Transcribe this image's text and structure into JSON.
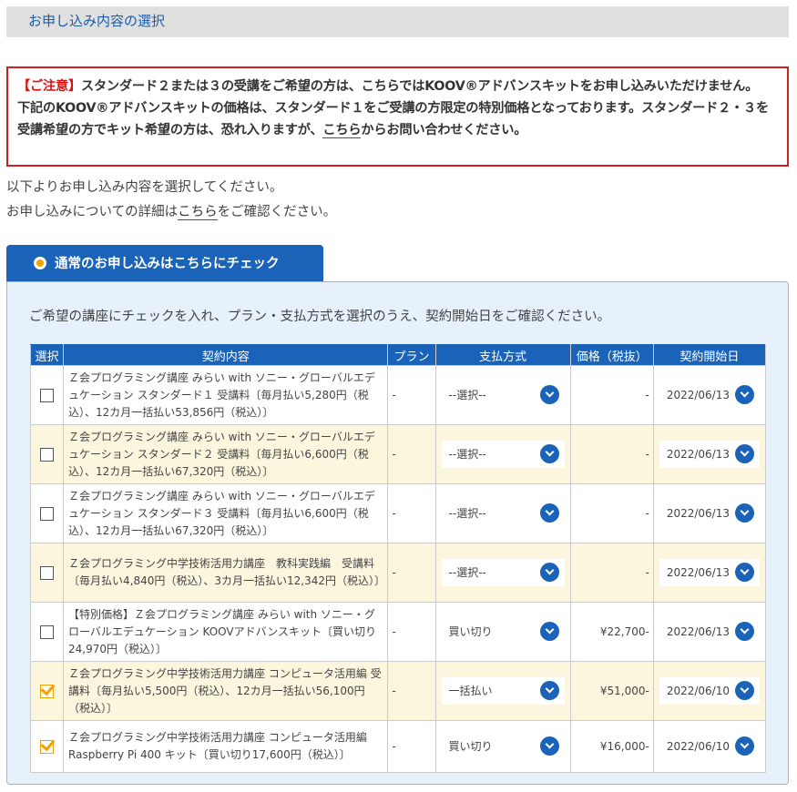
{
  "header": {
    "title": "お申し込み内容の選択"
  },
  "notice": {
    "tag": "【ご注意】",
    "line1": "スタンダード２または３の受講をご希望の方は、こちらではKOOV®アドバンスキットをお申し込みいただけません。",
    "line2_pre": "下記のKOOV®アドバンスキットの価格は、スタンダード１をご受講の方限定の特別価格となっております。スタンダード２・３を受講希望の方でキット希望の方は、恐れ入りますが、",
    "line2_link": "こちら",
    "line2_post": "からお問い合わせください。"
  },
  "intro": {
    "line1": "以下よりお申し込み内容を選択してください。",
    "line2_pre": "お申し込みについての詳細は",
    "line2_link": "こちら",
    "line2_post": "をご確認ください。"
  },
  "tab": {
    "label": "通常のお申し込みはこちらにチェック"
  },
  "panel": {
    "description": "ご希望の講座にチェックを入れ、プラン・支払方式を選択のうえ、契約開始日をご確認ください。"
  },
  "table": {
    "headers": [
      "選択",
      "契約内容",
      "プラン",
      "支払方式",
      "価格（税抜）",
      "契約開始日"
    ],
    "rows": [
      {
        "checked": false,
        "content": "Ｚ会プログラミング講座 みらい with ソニー・グローバルエデュケーション スタンダード１ 受講料〔毎月払い5,280円（税込）、12カ月一括払い53,856円（税込）〕",
        "plan": "-",
        "payment": "--選択--",
        "price": "-",
        "date": "2022/06/13"
      },
      {
        "checked": false,
        "content": "Ｚ会プログラミング講座 みらい with ソニー・グローバルエデュケーション スタンダード２ 受講料〔毎月払い6,600円（税込）、12カ月一括払い67,320円（税込）〕",
        "plan": "-",
        "payment": "--選択--",
        "price": "-",
        "date": "2022/06/13"
      },
      {
        "checked": false,
        "content": "Ｚ会プログラミング講座 みらい with ソニー・グローバルエデュケーション スタンダード３ 受講料〔毎月払い6,600円（税込）、12カ月一括払い67,320円（税込）〕",
        "plan": "-",
        "payment": "--選択--",
        "price": "-",
        "date": "2022/06/13"
      },
      {
        "checked": false,
        "content": "Ｚ会プログラミング中学技術活用力講座　教科実践編　受講料〔毎月払い4,840円（税込）、3カ月一括払い12,342円（税込）〕",
        "plan": "-",
        "payment": "--選択--",
        "price": "-",
        "date": "2022/06/13"
      },
      {
        "checked": false,
        "content": "【特別価格】Ｚ会プログラミング講座 みらい with ソニー・グローバルエデュケーション KOOVアドバンスキット〔買い切り24,970円（税込）〕",
        "plan": "-",
        "payment": "買い切り",
        "price": "¥22,700-",
        "date": "2022/06/13"
      },
      {
        "checked": true,
        "content": "Ｚ会プログラミング中学技術活用力講座 コンピュータ活用編 受講料〔毎月払い5,500円（税込）、12カ月一括払い56,100円（税込）〕",
        "plan": "-",
        "payment": "一括払い",
        "price": "¥51,000-",
        "date": "2022/06/10"
      },
      {
        "checked": true,
        "content": "Ｚ会プログラミング中学技術活用力講座 コンピュータ活用編 Raspberry Pi 400 キット〔買い切り17,600円（税込）〕",
        "plan": "-",
        "payment": "買い切り",
        "price": "¥16,000-",
        "date": "2022/06/10"
      }
    ]
  },
  "icons": {
    "checkbox": "checkbox-icon",
    "dropdown": "chevron-down-icon",
    "radio": "radio-selected-icon"
  },
  "colors": {
    "accent": "#1a63b8",
    "warning": "#cc2222",
    "check": "#f0a000",
    "row_alt": "#fdf6df"
  }
}
